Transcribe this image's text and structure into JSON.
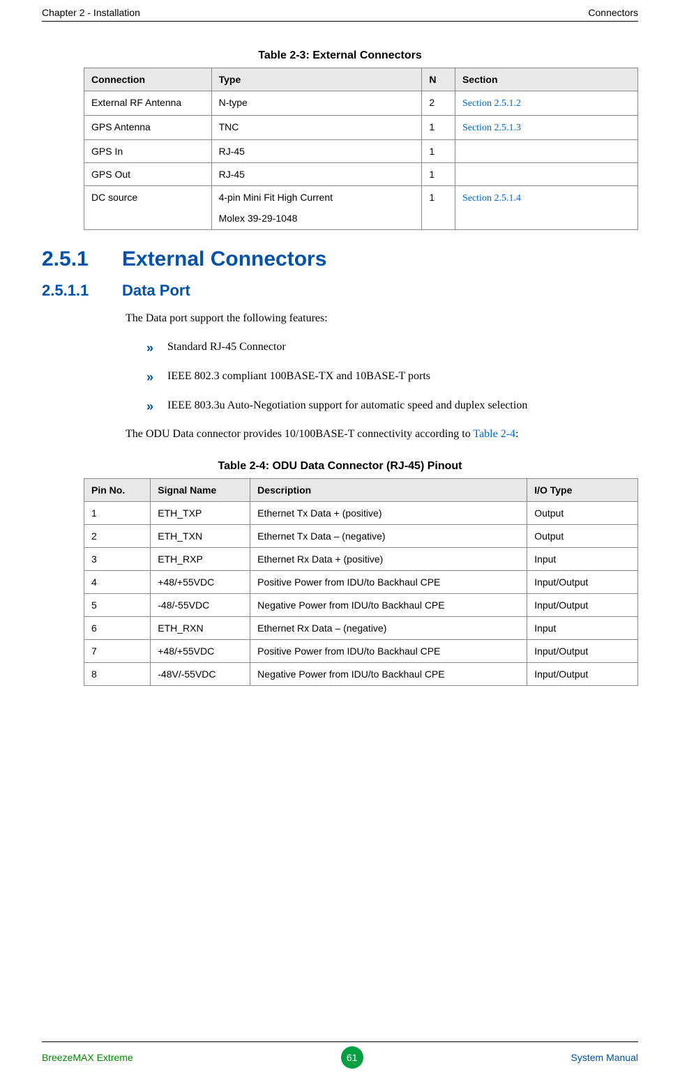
{
  "header": {
    "left": "Chapter 2 - Installation",
    "right": "Connectors"
  },
  "table1": {
    "caption": "Table 2-3: External Connectors",
    "headers": [
      "Connection",
      "Type",
      "N",
      "Section"
    ],
    "rows": [
      {
        "c0": "External RF Antenna",
        "c1": "N-type",
        "c2": "2",
        "c3": "Section 2.5.1.2",
        "link": true
      },
      {
        "c0": "GPS Antenna",
        "c1": "TNC",
        "c2": "1",
        "c3": "Section 2.5.1.3",
        "link": true
      },
      {
        "c0": "GPS In",
        "c1": "RJ-45",
        "c2": "1",
        "c3": "",
        "link": false
      },
      {
        "c0": "GPS Out",
        "c1": "RJ-45",
        "c2": "1",
        "c3": "",
        "link": false
      },
      {
        "c0": "DC source",
        "c1": "4-pin Mini Fit High Current",
        "c1b": "Molex 39-29-1048",
        "c2": "1",
        "c3": "Section 2.5.1.4",
        "link": true
      }
    ]
  },
  "section": {
    "num": "2.5.1",
    "title": "External Connectors"
  },
  "subsection": {
    "num": "2.5.1.1",
    "title": "Data Port"
  },
  "para1": "The Data port support the following features:",
  "bullets": [
    "Standard RJ-45 Connector",
    "IEEE 802.3 compliant 100BASE-TX and 10BASE-T ports",
    "IEEE 803.3u Auto-Negotiation support for automatic speed and duplex selection"
  ],
  "para2_a": "The ODU Data connector provides 10/100BASE-T connectivity according to ",
  "para2_link": "Table 2-4",
  "para2_b": ":",
  "table2": {
    "caption": "Table 2-4: ODU Data Connector (RJ-45) Pinout",
    "headers": [
      "Pin No.",
      "Signal Name",
      "Description",
      "I/O Type"
    ],
    "rows": [
      {
        "c0": "1",
        "c1": "ETH_TXP",
        "c2": "Ethernet Tx Data + (positive)",
        "c3": "Output"
      },
      {
        "c0": "2",
        "c1": "ETH_TXN",
        "c2": "Ethernet Tx Data – (negative)",
        "c3": "Output"
      },
      {
        "c0": "3",
        "c1": "ETH_RXP",
        "c2": "Ethernet Rx Data + (positive)",
        "c3": "Input"
      },
      {
        "c0": "4",
        "c1": "+48/+55VDC",
        "c2": "Positive Power from IDU/to Backhaul CPE",
        "c3": "Input/Output"
      },
      {
        "c0": "5",
        "c1": "-48/-55VDC",
        "c2": "Negative Power  from IDU/to Backhaul CPE",
        "c3": "Input/Output"
      },
      {
        "c0": "6",
        "c1": "ETH_RXN",
        "c2": "Ethernet Rx Data – (negative)",
        "c3": "Input"
      },
      {
        "c0": "7",
        "c1": "+48/+55VDC",
        "c2": "Positive Power  from IDU/to Backhaul CPE",
        "c3": "Input/Output"
      },
      {
        "c0": "8",
        "c1": "-48V/-55VDC",
        "c2": "Negative Power  from IDU/to Backhaul CPE",
        "c3": "Input/Output"
      }
    ]
  },
  "footer": {
    "left": "BreezeMAX Extreme",
    "page": "61",
    "right": "System Manual"
  }
}
